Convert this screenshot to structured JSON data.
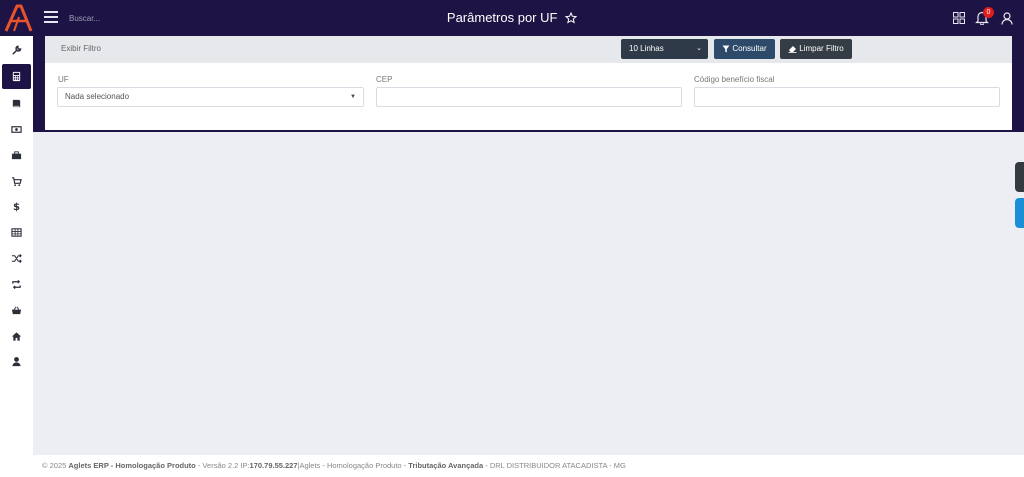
{
  "header": {
    "search_placeholder": "Buscar...",
    "page_title": "Parâmetros por UF",
    "notification_count": "0"
  },
  "sidebar": {
    "items": [
      {
        "icon": "wrench-icon"
      },
      {
        "icon": "calculator-icon",
        "active": true
      },
      {
        "icon": "book-icon"
      },
      {
        "icon": "money-icon"
      },
      {
        "icon": "briefcase-icon"
      },
      {
        "icon": "cart-icon"
      },
      {
        "icon": "dollar-icon"
      },
      {
        "icon": "table-icon"
      },
      {
        "icon": "shuffle-icon"
      },
      {
        "icon": "retweet-icon"
      },
      {
        "icon": "basket-icon"
      },
      {
        "icon": "home-icon"
      },
      {
        "icon": "user-icon"
      }
    ]
  },
  "filter": {
    "toggle_label": "Exibir Filtro",
    "lines_select": "10 Linhas",
    "consultar_label": "Consultar",
    "limpar_label": "Limpar Filtro",
    "uf_label": "UF",
    "uf_value": "Nada selecionado",
    "cep_label": "CEP",
    "cep_value": "",
    "cbf_label": "Código benefício fiscal",
    "cbf_value": ""
  },
  "footer": {
    "copyright": "© 2025 ",
    "app_name": "Aglets ERP - Homologação Produto",
    "version": " - Versão 2.2  IP:",
    "ip": "170.79.55.227",
    "env": "|Aglets - Homologação Produto - ",
    "module": "Tributação Avançada",
    "company": " - DRL DISTRIBUIDOR ATACADISTA - MG"
  },
  "colors": {
    "header_bg": "#1e1345",
    "logo_accent": "#e8542c",
    "badge": "#e01d1d",
    "consultar_btn": "#2e4a6a",
    "limpar_btn": "#343d46",
    "right_tab_blue": "#1a8fd6"
  }
}
